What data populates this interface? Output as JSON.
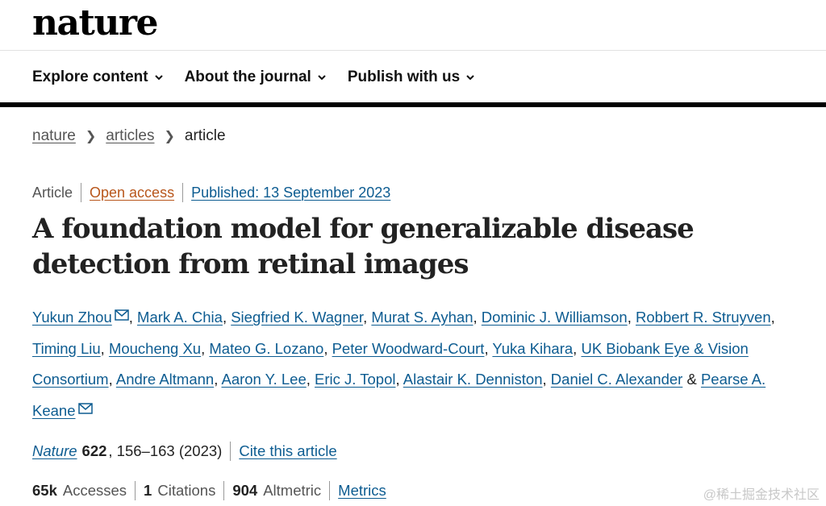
{
  "header": {
    "logo": "nature"
  },
  "nav": {
    "items": [
      {
        "label": "Explore content"
      },
      {
        "label": "About the journal"
      },
      {
        "label": "Publish with us"
      }
    ]
  },
  "breadcrumb": {
    "root": "nature",
    "section": "articles",
    "current": "article"
  },
  "meta": {
    "type": "Article",
    "access": "Open access",
    "published": "Published: 13 September 2023"
  },
  "article": {
    "title": "A foundation model for generalizable disease detection from retinal images"
  },
  "authors": [
    "Yukun Zhou",
    "Mark A. Chia",
    "Siegfried K. Wagner",
    "Murat S. Ayhan",
    "Dominic J. Williamson",
    "Robbert R. Struyven",
    "Timing Liu",
    "Moucheng Xu",
    "Mateo G. Lozano",
    "Peter Woodward-Court",
    "Yuka Kihara",
    "UK Biobank Eye & Vision Consortium",
    "Andre Altmann",
    "Aaron Y. Lee",
    "Eric J. Topol",
    "Alastair K. Denniston",
    "Daniel C. Alexander",
    "Pearse A. Keane"
  ],
  "authors_joiner": "&",
  "citation": {
    "journal": "Nature",
    "volume": "622",
    "pages": ", 156–163 (2023)",
    "cite_link": "Cite this article"
  },
  "metrics": {
    "accesses_value": "65k",
    "accesses_label": "Accesses",
    "citations_value": "1",
    "citations_label": "Citations",
    "altmetric_value": "904",
    "altmetric_label": "Altmetric",
    "metrics_link": "Metrics"
  },
  "watermark": "@稀土掘金技术社区",
  "colors": {
    "link": "#0d5c91",
    "open_access": "#b8561b",
    "rule": "#000000"
  },
  "icons": {
    "nav_chevron": "chevron-down-icon",
    "author_contact": "envelope-icon"
  }
}
